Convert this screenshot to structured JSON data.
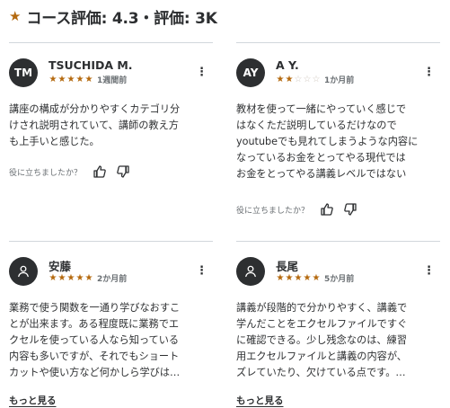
{
  "header": {
    "title": "コース評価: 4.3・評価: 3K",
    "star_icon": "star-icon"
  },
  "reviews": [
    {
      "initials": "TM",
      "name": "TSUCHIDA M.",
      "stars": [
        1,
        1,
        1,
        1,
        0.5
      ],
      "date": "1週間前",
      "lines": [
        "講座の構成が分かりやすくカテゴリ分",
        "けされ説明されていて、講師の教え方",
        "も上手いと感じた。"
      ],
      "helpful_label": "役に立ちましたか？"
    },
    {
      "initials": "AY",
      "name": "A Y.",
      "stars": [
        1,
        1,
        0,
        0,
        0
      ],
      "date": "1か月前",
      "lines": [
        "教材を使って一緒にやっていく感じで",
        "はなくただ説明しているだけなので",
        "youtubeでも見れてしまうような内容に",
        "なっているお金をとってやる現代では",
        "お金をとってやる講義レベルではない"
      ],
      "helpful_label": "役に立ちましたか？"
    },
    {
      "initials": "",
      "name": "安藤",
      "stars": [
        1,
        1,
        1,
        1,
        1
      ],
      "date": "2か月前",
      "lines": [
        "業務で使う関数を一通り学びなおすこ",
        "とが出来ます。ある程度既に業務でエ",
        "クセルを使っている人なら知っている",
        "内容も多いですが、それでもショート",
        "カットや使い方など何かしら学びは…"
      ],
      "show_more": "もっと見る"
    },
    {
      "initials": "",
      "name": "長尾",
      "stars": [
        1,
        1,
        1,
        1,
        1
      ],
      "date": "5か月前",
      "lines": [
        "講義が段階的で分かりやすく、講義で",
        "学んだことをエクセルファイルですぐ",
        "に確認できる。少し残念なのは、練習",
        "用エクセルファイルと講義の内容が、",
        "ズレていたり、欠けている点です。…"
      ],
      "show_more": "もっと見る"
    }
  ]
}
